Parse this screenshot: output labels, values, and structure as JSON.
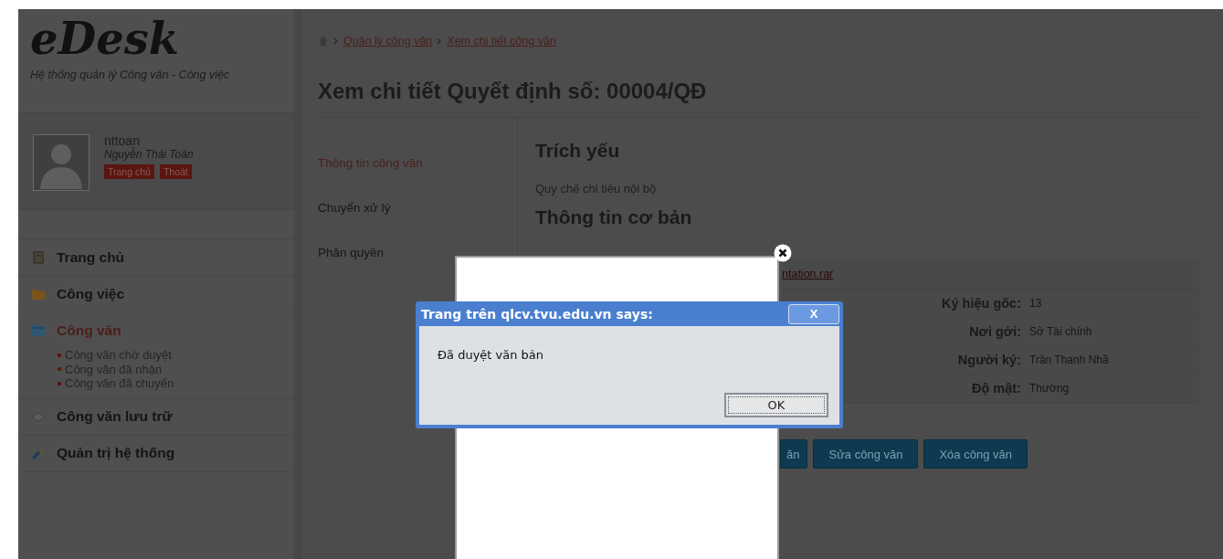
{
  "logo": {
    "title": "eDesk",
    "subtitle": "Hệ thống quản lý Công văn - Công việc"
  },
  "user": {
    "username": "nttoan",
    "full_name": "Nguyễn Thái Toàn",
    "links": [
      "Trang chủ",
      "Thoát"
    ]
  },
  "menu": [
    {
      "label": "Trang chủ",
      "kind": "home",
      "selected": false
    },
    {
      "label": "Công việc",
      "kind": "work",
      "selected": false
    },
    {
      "label": "Công văn",
      "kind": "document",
      "selected": true,
      "children": [
        "Công văn chờ duyệt",
        "Công văn đã nhận",
        "Công văn đã chuyển"
      ]
    },
    {
      "label": "Công văn lưu trữ",
      "kind": "archive",
      "selected": false
    },
    {
      "label": "Quản trị hệ thống",
      "kind": "admin",
      "selected": false
    }
  ],
  "breadcrumb": [
    "Quản lý công văn",
    "Xem chi tiết công văn"
  ],
  "page_title": "Xem chi tiết Quyết định số: 00004/QĐ",
  "tabs": [
    {
      "label": "Thông tin công văn",
      "selected": true
    },
    {
      "label": "Chuyển xử lý",
      "selected": false
    },
    {
      "label": "Phân quyền",
      "selected": false
    }
  ],
  "summary": {
    "heading": "Trích yếu",
    "text": "Quy chế chi tiêu nội bộ"
  },
  "basic_info": {
    "heading": "Thông tin cơ bản",
    "attachment": "ntation.rar",
    "fields": [
      {
        "label": "Ký hiệu gốc:",
        "value": "13"
      },
      {
        "label": "Nơi gởi:",
        "value": "Sở Tài chính"
      },
      {
        "label": "Người ký:",
        "value": "Trần Thanh Nhã"
      },
      {
        "label": "Độ mật:",
        "value": "Thường"
      }
    ]
  },
  "buttons": [
    "ăn",
    "Sửa công văn",
    "Xóa công văn"
  ],
  "alert": {
    "title": "Trang trên qlcv.tvu.edu.vn says:",
    "close_label": "X",
    "message": "Đã duyệt văn bản",
    "button": "OK"
  }
}
